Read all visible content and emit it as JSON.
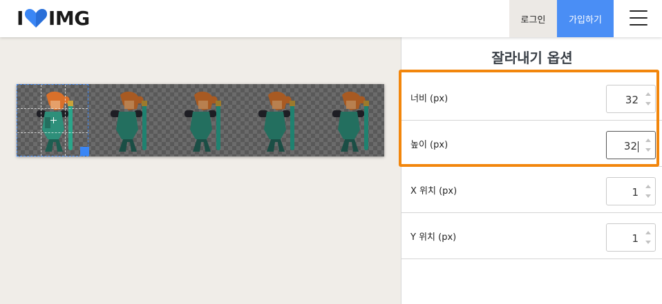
{
  "header": {
    "logo_left": "I",
    "logo_right": "IMG",
    "login_label": "로그인",
    "signup_label": "가입하기",
    "menu_icon": "hamburger-icon"
  },
  "colors": {
    "accent": "#4a8ef5",
    "highlight": "#f2860c",
    "crop_selection": "#3a86f5"
  },
  "panel": {
    "title": "잘라내기 옵션",
    "fields": [
      {
        "label": "너비 (px)",
        "value": "32"
      },
      {
        "label": "높이 (px)",
        "value": "32"
      },
      {
        "label": "X 위치 (px)",
        "value": "1"
      },
      {
        "label": "Y 위치 (px)",
        "value": "1"
      }
    ]
  },
  "canvas": {
    "frame_count": 5
  }
}
